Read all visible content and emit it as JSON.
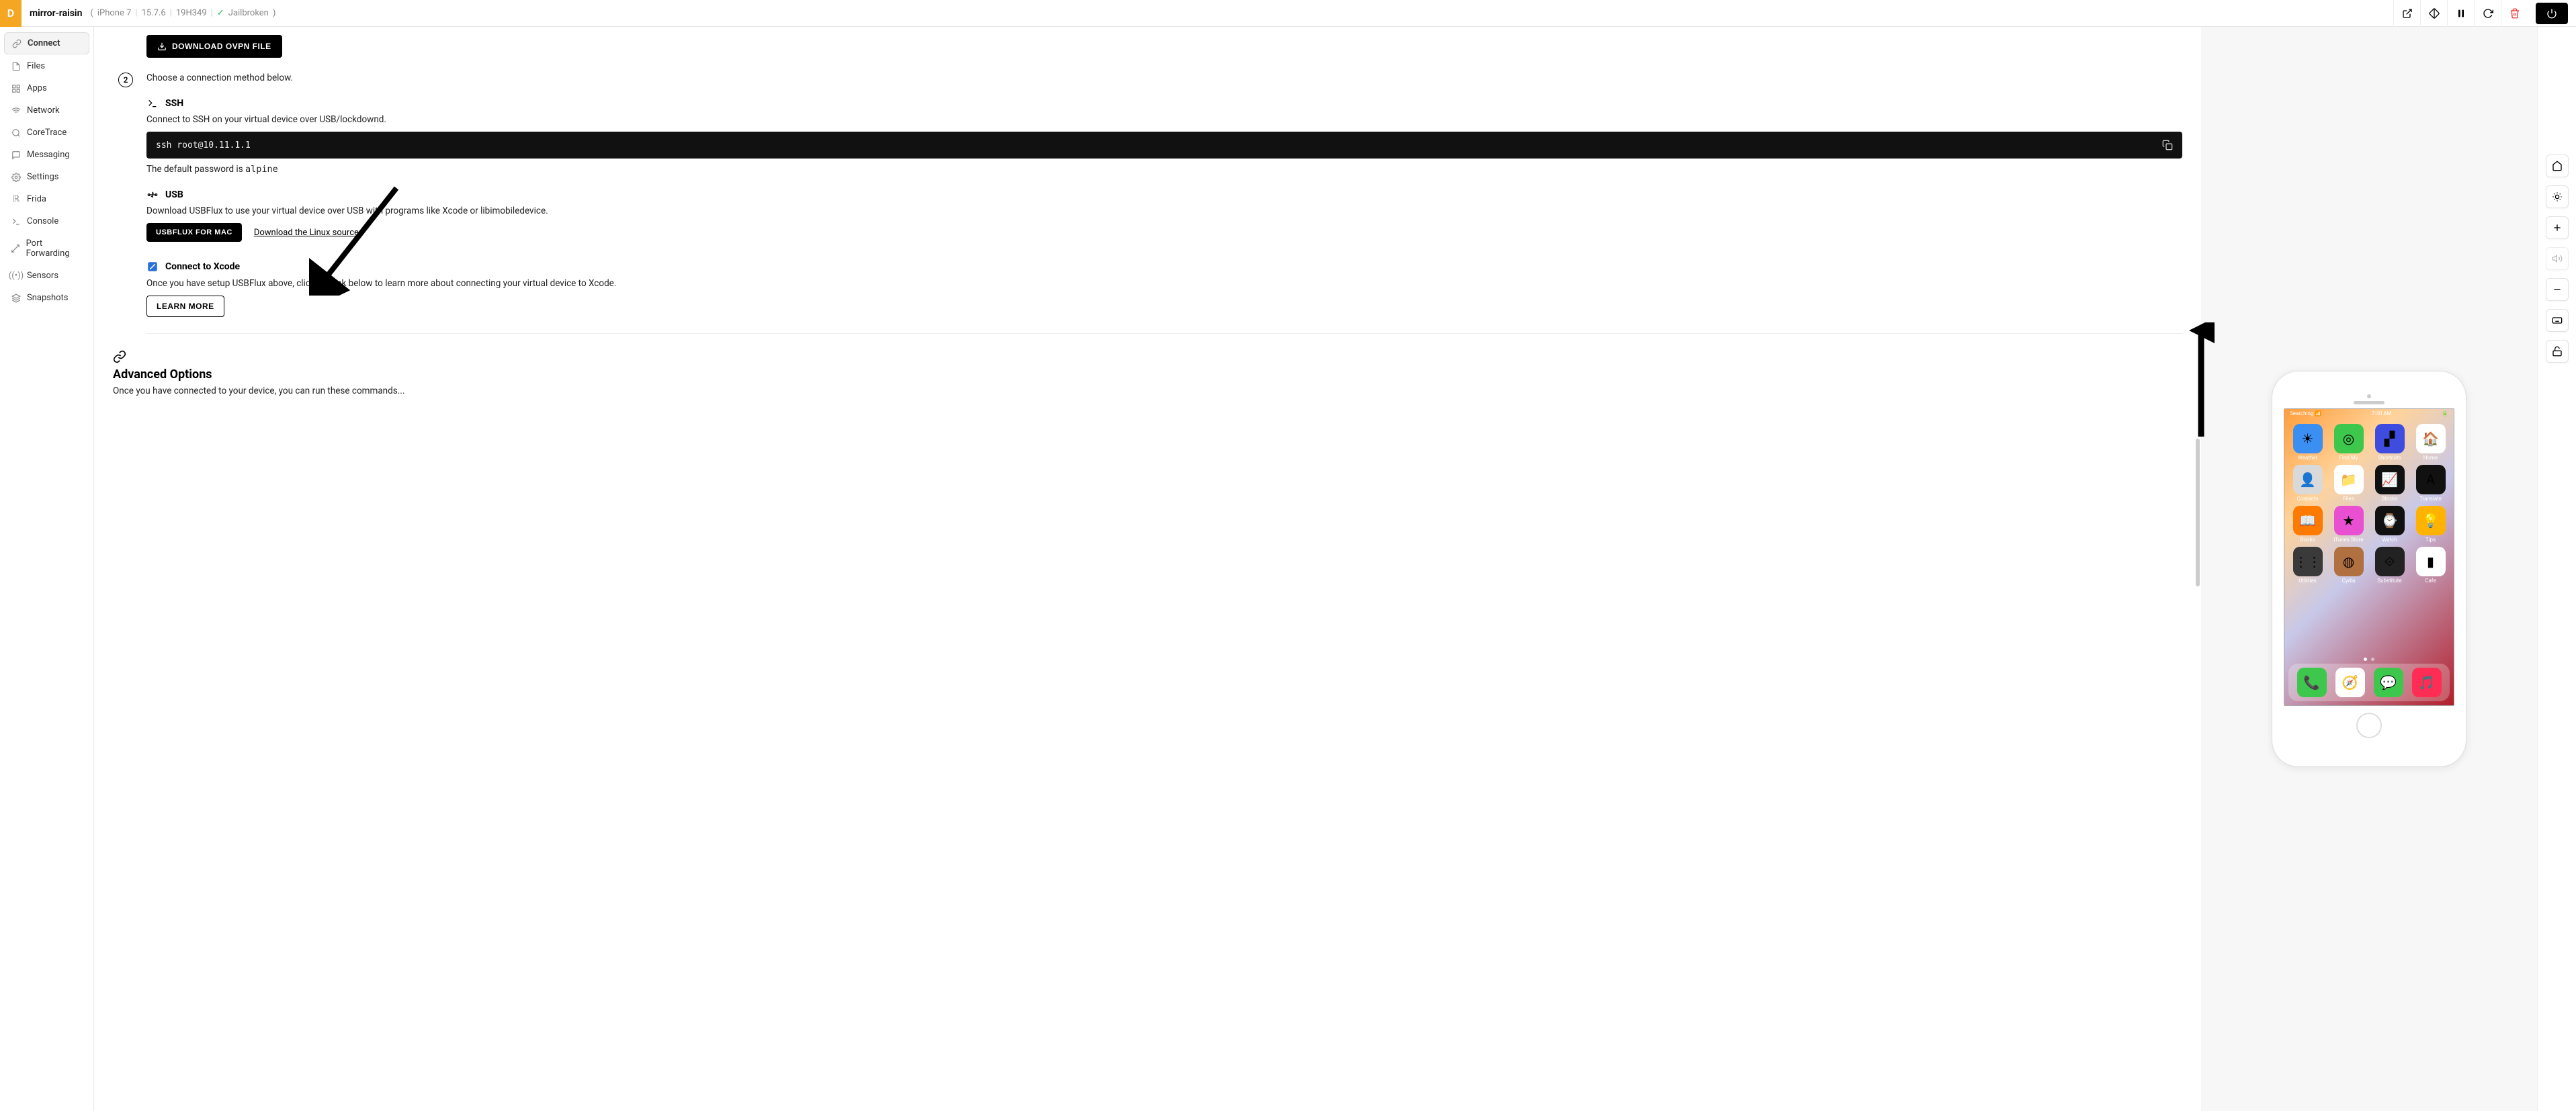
{
  "topbar": {
    "badge": "D",
    "device_name": "mirror-raisin",
    "model": "iPhone 7",
    "os": "15.7.6",
    "build": "19H349",
    "jailbroken_label": "Jailbroken"
  },
  "sidebar": {
    "items": [
      {
        "label": "Connect"
      },
      {
        "label": "Files"
      },
      {
        "label": "Apps"
      },
      {
        "label": "Network"
      },
      {
        "label": "CoreTrace"
      },
      {
        "label": "Messaging"
      },
      {
        "label": "Settings"
      },
      {
        "label": "Frida"
      },
      {
        "label": "Console"
      },
      {
        "label": "Port Forwarding"
      },
      {
        "label": "Sensors"
      },
      {
        "label": "Snapshots"
      }
    ]
  },
  "main": {
    "download_ovpn_label": "DOWNLOAD OVPN FILE",
    "step2_text": "Choose a connection method below.",
    "ssh": {
      "title": "SSH",
      "desc": "Connect to SSH on your virtual device over USB/lockdownd.",
      "cmd": "ssh root@10.11.1.1",
      "pwd_prefix": "The default password is ",
      "pwd_value": "alpine"
    },
    "usb": {
      "title": "USB",
      "desc": "Download USBFlux to use your virtual device over USB with programs like Xcode or libimobiledevice.",
      "btn": "USBFLUX FOR MAC",
      "linux_link": "Download the Linux source"
    },
    "xcode": {
      "title": "Connect to Xcode",
      "desc": "Once you have setup USBFlux above, click the link below to learn more about connecting your virtual device to Xcode.",
      "learn": "LEARN MORE"
    },
    "advanced": {
      "title": "Advanced Options",
      "desc": "Once you have connected to your device, you can run these commands..."
    }
  },
  "phone": {
    "status_left": "Searching",
    "status_time": "7:40 AM",
    "apps_row": [
      {
        "label": "Weather",
        "bg": "#3b8ff2",
        "glyph": "☀"
      },
      {
        "label": "Find My",
        "bg": "#3dc84d",
        "glyph": "◎"
      },
      {
        "label": "Shortcuts",
        "bg": "#3f4ce0",
        "glyph": "▞"
      },
      {
        "label": "Home",
        "bg": "#ffffff",
        "glyph": "🏠"
      },
      {
        "label": "Contacts",
        "bg": "#d9d9d9",
        "glyph": "👤"
      },
      {
        "label": "Files",
        "bg": "#ffffff",
        "glyph": "📁"
      },
      {
        "label": "Stocks",
        "bg": "#111111",
        "glyph": "📈"
      },
      {
        "label": "Translate",
        "bg": "#111111",
        "glyph": "A"
      },
      {
        "label": "Books",
        "bg": "#ff7a00",
        "glyph": "📖"
      },
      {
        "label": "iTunes Store",
        "bg": "#e84fd1",
        "glyph": "★"
      },
      {
        "label": "Watch",
        "bg": "#111111",
        "glyph": "⌚"
      },
      {
        "label": "Tips",
        "bg": "#ffb300",
        "glyph": "💡"
      },
      {
        "label": "Utilities",
        "bg": "#3a3a3a",
        "glyph": "⋮⋮"
      },
      {
        "label": "Cydia",
        "bg": "#b07040",
        "glyph": "◍"
      },
      {
        "label": "Substitute",
        "bg": "#222222",
        "glyph": "⟐"
      },
      {
        "label": "Cafe",
        "bg": "#ffffff",
        "glyph": "▮"
      }
    ],
    "dock": [
      {
        "bg": "#3dc84d",
        "glyph": "📞"
      },
      {
        "bg": "#ffffff",
        "glyph": "🧭"
      },
      {
        "bg": "#3dc84d",
        "glyph": "💬"
      },
      {
        "bg": "#ff2d55",
        "glyph": "🎵"
      }
    ]
  }
}
